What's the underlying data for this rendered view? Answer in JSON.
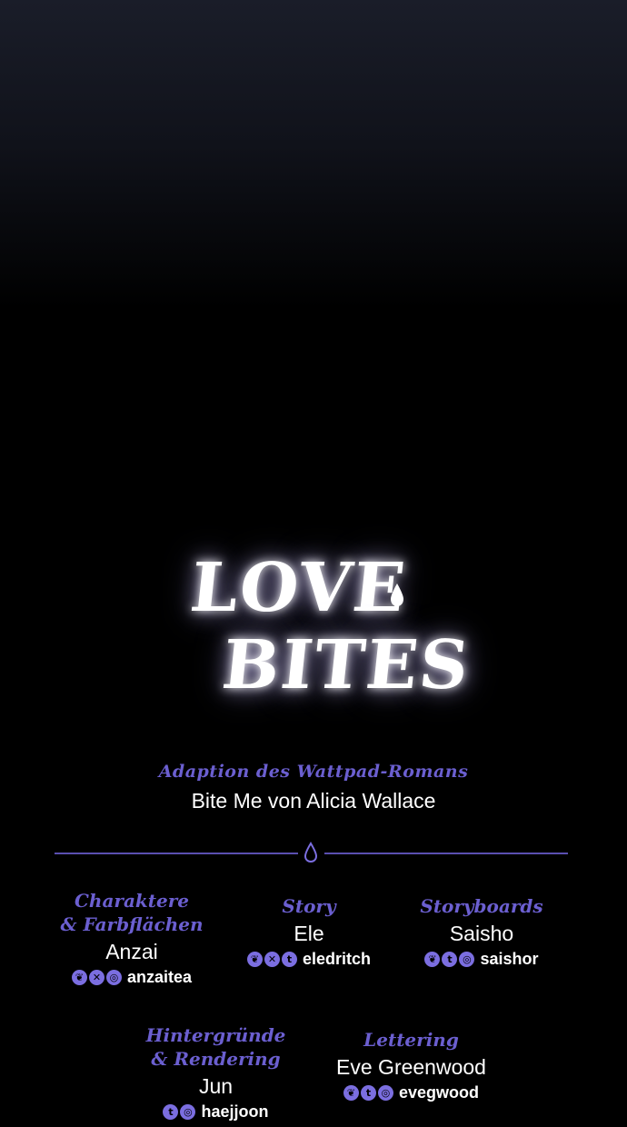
{
  "logo": {
    "line1": "LOVE",
    "line2": "BITES"
  },
  "subtitle": "Adaption des Wattpad-Romans",
  "source": "Bite Me von Alicia Wallace",
  "colors": {
    "accent": "#6b5fd0",
    "icon": "#7b6ee0",
    "text": "#ffffff",
    "background": "#000000"
  },
  "credits": {
    "charaktere": {
      "role_line1": "Charaktere",
      "role_line2": "& Farbflächen",
      "name": "Anzai",
      "icons": [
        "bluesky-icon",
        "x-icon",
        "instagram-icon"
      ],
      "handle": "anzaitea"
    },
    "story": {
      "role_line1": "Story",
      "name": "Ele",
      "icons": [
        "bluesky-icon",
        "x-icon",
        "tumblr-icon"
      ],
      "handle": "eledritch"
    },
    "storyboards": {
      "role_line1": "Storyboards",
      "name": "Saisho",
      "icons": [
        "bluesky-icon",
        "tumblr-icon",
        "instagram-icon"
      ],
      "handle": "saishor"
    },
    "hintergruende": {
      "role_line1": "Hintergründe",
      "role_line2": "& Rendering",
      "name": "Jun",
      "icons": [
        "tumblr-icon",
        "instagram-icon"
      ],
      "handle": "haejjoon"
    },
    "lettering": {
      "role_line1": "Lettering",
      "name": "Eve Greenwood",
      "icons": [
        "bluesky-icon",
        "tumblr-icon",
        "instagram-icon"
      ],
      "handle": "evegwood"
    }
  }
}
